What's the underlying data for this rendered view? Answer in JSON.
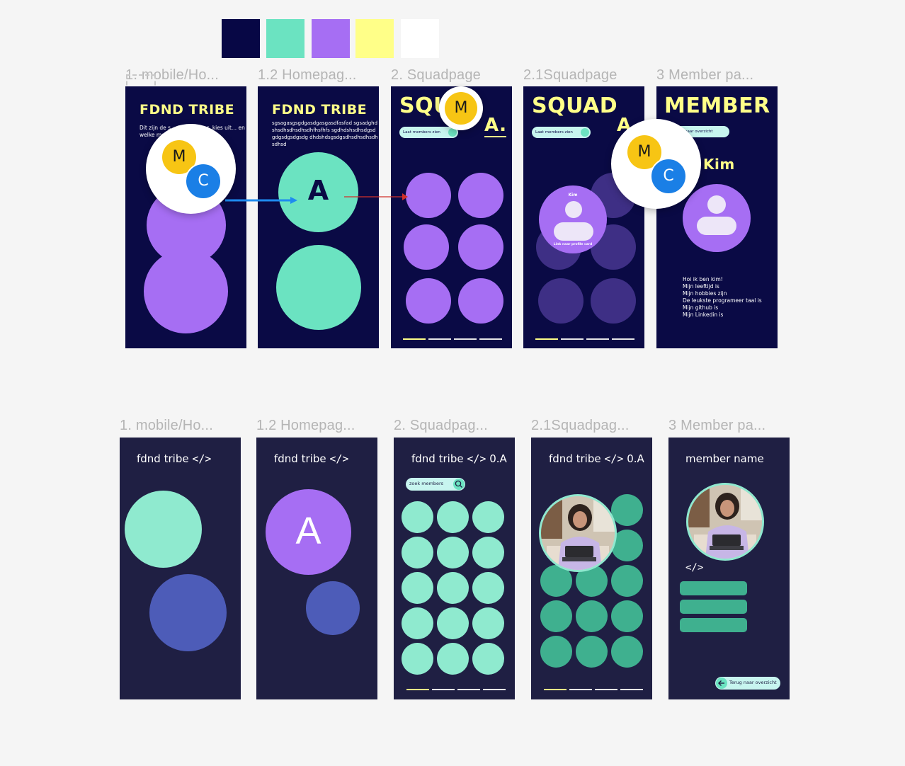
{
  "palette": [
    {
      "name": "navy",
      "hex": "#070745"
    },
    {
      "name": "mint",
      "hex": "#6be3c1"
    },
    {
      "name": "purple",
      "hex": "#a66ef3"
    },
    {
      "name": "yellow",
      "hex": "#ffff88"
    },
    {
      "name": "white",
      "hex": "#ffffff"
    }
  ],
  "row1": {
    "labels": [
      "1. mobile/Ho...",
      "1.2 Homepag...",
      "2. Squadpage",
      "2.1Squadpage",
      "3 Member pa..."
    ],
    "f1": {
      "title": "FDND TRIBE",
      "intro": "Dit zijn de s... tweede jaar, kies uit... en welke memb..."
    },
    "f2": {
      "title": "FDND TRIBE",
      "body": "sgsagasgsgdgasdgasgasdfasfad sgsadghdshsdhsdhsdhsdhfhsfhfs sgdhdshsdhsdgsdgdgsdgsdgsdg dhdshdsgsdgsdhsdhsdhsdhsdhsd",
      "circle_letter": "A"
    },
    "f3": {
      "title": "SQU",
      "squad": "A.",
      "toggle": "Laat members zien"
    },
    "f4": {
      "title": "SQUAD",
      "squad": "A",
      "toggle": "Laat members zien",
      "card_name": "Kim",
      "card_link": "Link naar profile card"
    },
    "f5": {
      "title": "MEMBER",
      "back": "naar overzicht",
      "name": "Kim",
      "bio": [
        "Hoi ik ben kim!",
        "Mijn leeftijd is",
        "Mijn hobbies zijn",
        "De leukste programeer taal is",
        "Mijn github is",
        "Mijn Linkedin is"
      ]
    }
  },
  "row2": {
    "labels": [
      "1. mobile/Ho...",
      "1.2 Homepag...",
      "2. Squadpag...",
      "2.1Squadpag...",
      "3 Member pa..."
    ],
    "f1": {
      "title": "fdnd tribe",
      "code": "</>"
    },
    "f2": {
      "title": "fdnd tribe",
      "code": "</>",
      "letter": "A"
    },
    "f3": {
      "title": "fdnd tribe",
      "code": "</>",
      "suffix": "0.A",
      "search": "zoek members"
    },
    "f4": {
      "title": "fdnd tribe",
      "code": "</>",
      "suffix": "0.A"
    },
    "f5": {
      "title": "member name",
      "code": "</>",
      "back": "Terug naar overzicht"
    }
  },
  "cursors": {
    "m": "M",
    "c": "C"
  }
}
